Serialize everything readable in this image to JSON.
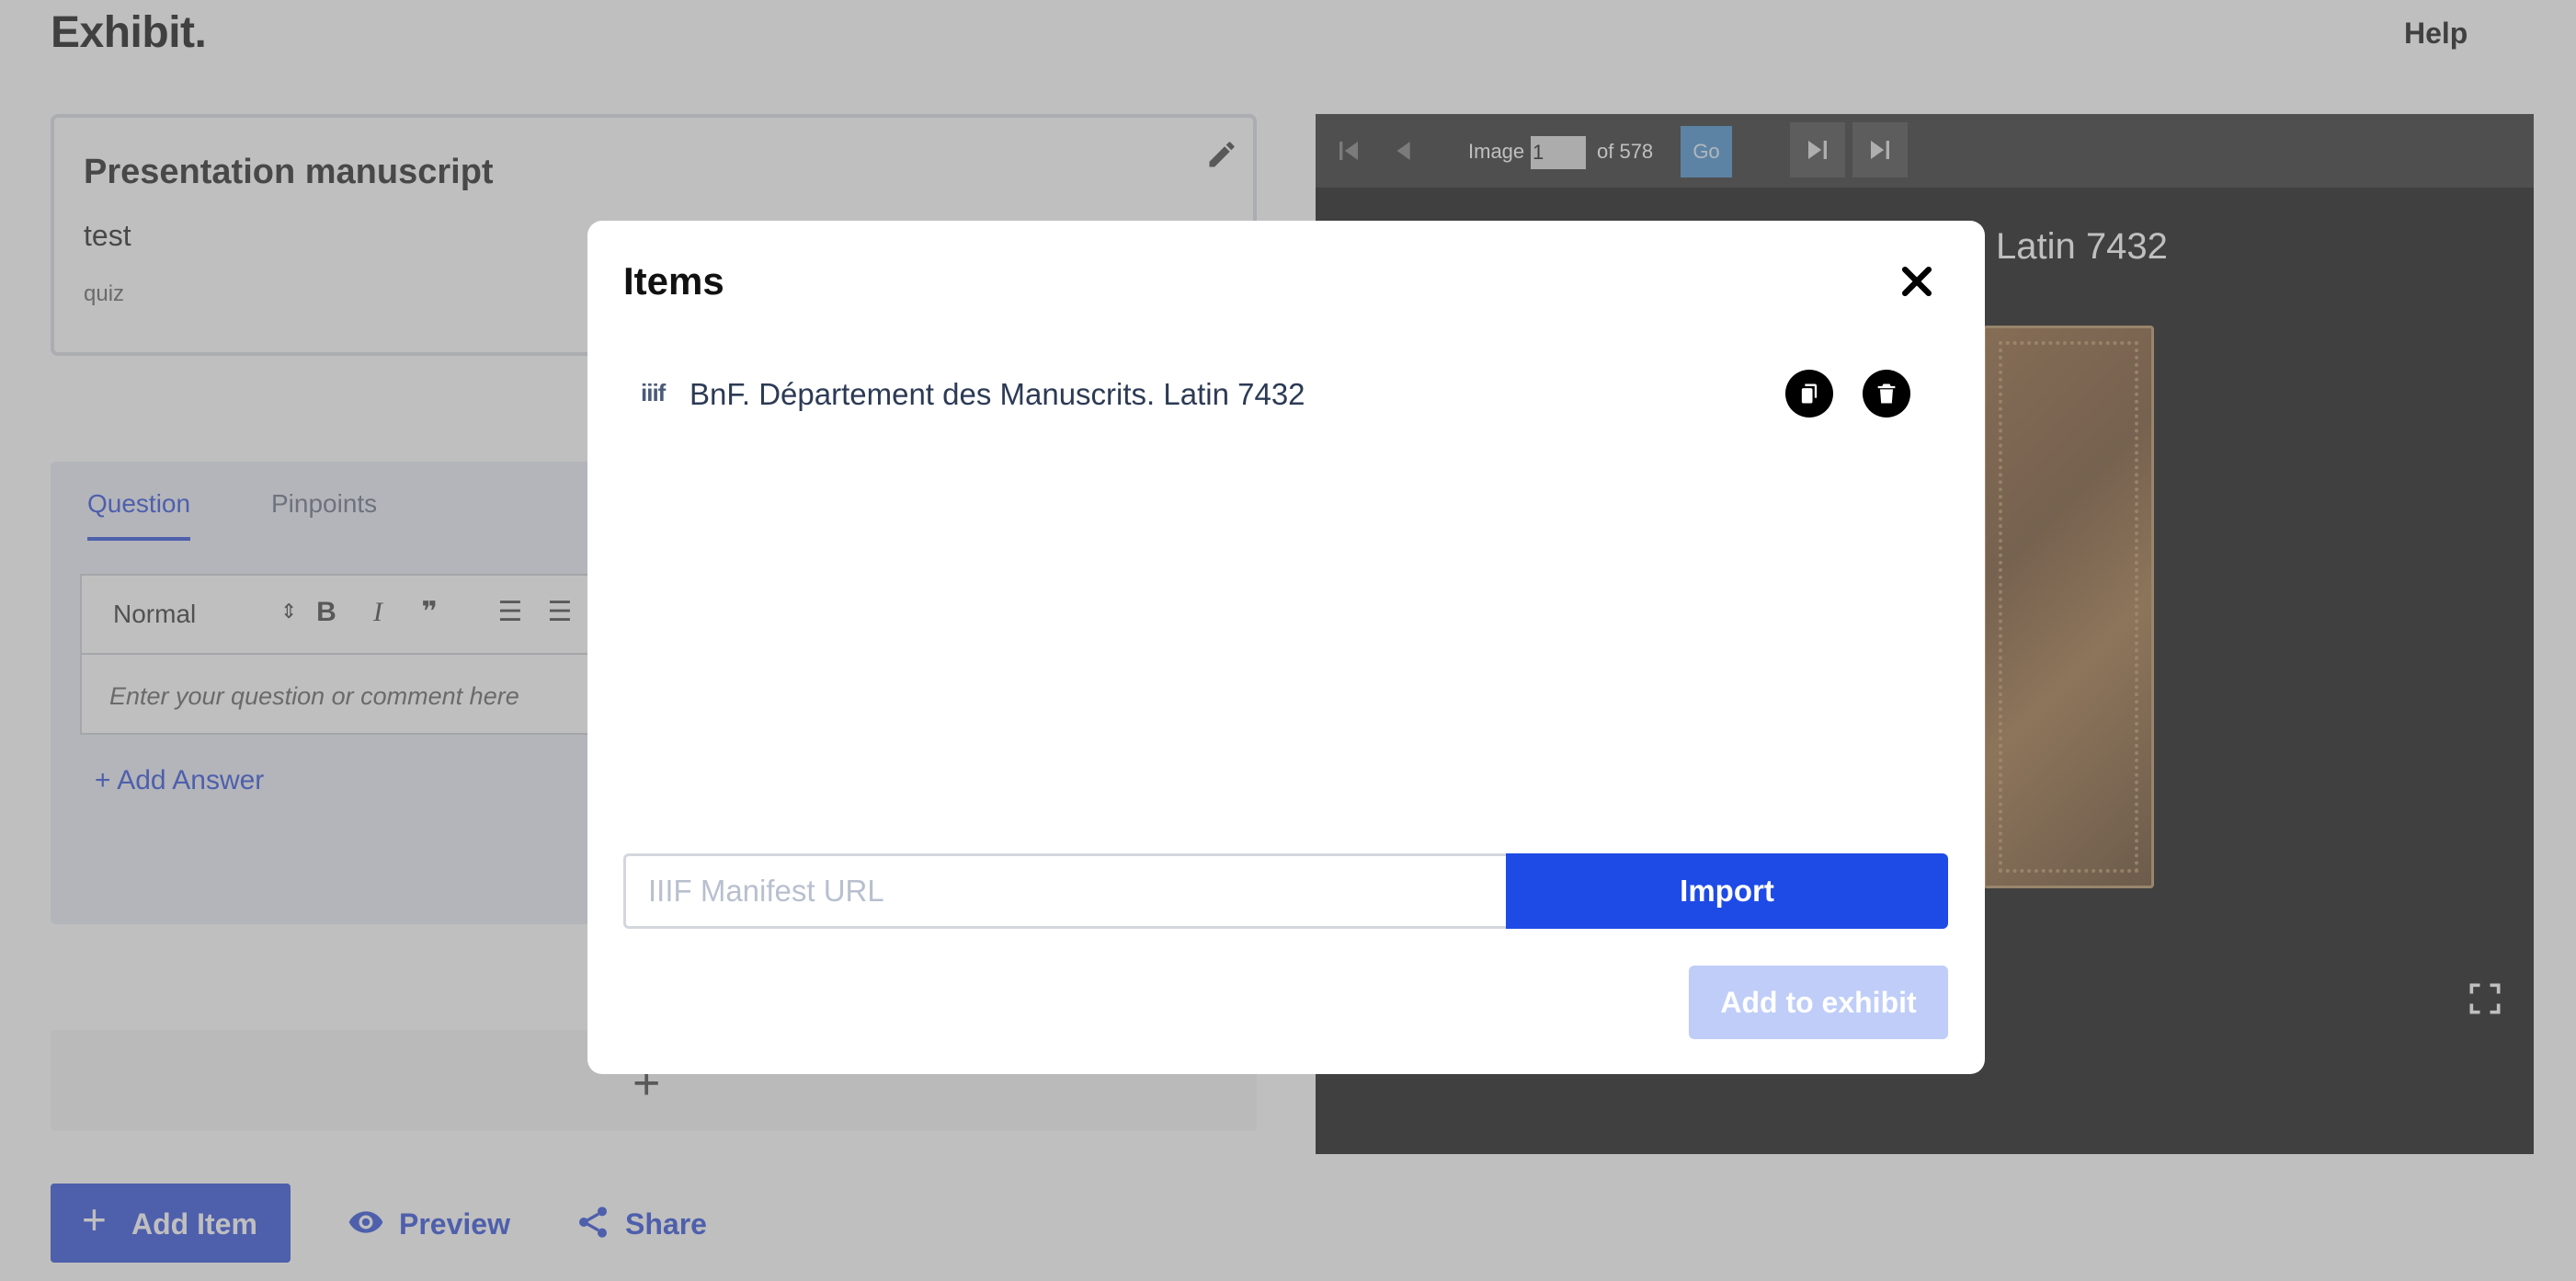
{
  "header": {
    "brand": "Exhibit.",
    "help_label": "Help"
  },
  "card": {
    "title": "Presentation manuscript",
    "description": "test",
    "type": "quiz"
  },
  "question_panel": {
    "tabs": [
      {
        "label": "Question",
        "active": true
      },
      {
        "label": "Pinpoints",
        "active": false
      }
    ],
    "format_select": "Normal",
    "editor_placeholder": "Enter your question or comment here",
    "add_answer_label": "+ Add Answer"
  },
  "viewer": {
    "image_label": "Image",
    "current_image": "1",
    "of_label": "of 578",
    "go_label": "Go",
    "title_visible": "Latin 7432"
  },
  "actions": {
    "add_item_label": "Add Item",
    "preview_label": "Preview",
    "share_label": "Share"
  },
  "modal": {
    "title": "Items",
    "items": [
      {
        "icon": "iiif",
        "label": "BnF. Département des Manuscrits. Latin 7432"
      }
    ],
    "manifest_placeholder": "IIIF Manifest URL",
    "import_label": "Import",
    "add_to_exhibit_label": "Add to exhibit"
  },
  "colors": {
    "accent": "#1c3fd8",
    "import_button": "#1e4be6",
    "disabled_button": "#bfcdf8",
    "go_button": "#3a86c8"
  }
}
